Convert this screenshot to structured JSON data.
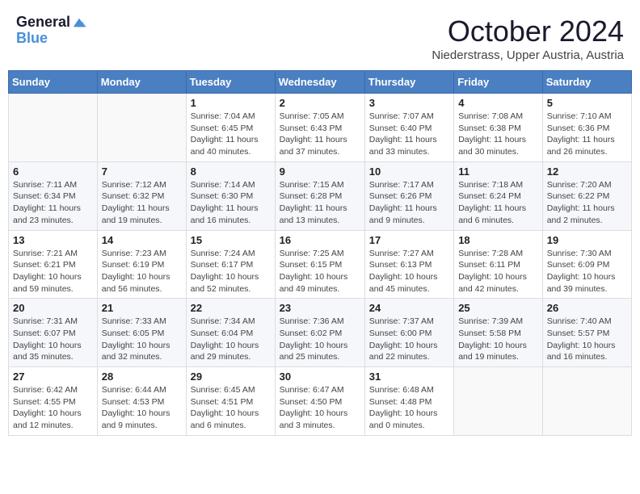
{
  "header": {
    "logo_line1": "General",
    "logo_line2": "Blue",
    "month_title": "October 2024",
    "location": "Niederstrass, Upper Austria, Austria"
  },
  "weekdays": [
    "Sunday",
    "Monday",
    "Tuesday",
    "Wednesday",
    "Thursday",
    "Friday",
    "Saturday"
  ],
  "weeks": [
    [
      {
        "day": "",
        "content": ""
      },
      {
        "day": "",
        "content": ""
      },
      {
        "day": "1",
        "content": "Sunrise: 7:04 AM\nSunset: 6:45 PM\nDaylight: 11 hours and 40 minutes."
      },
      {
        "day": "2",
        "content": "Sunrise: 7:05 AM\nSunset: 6:43 PM\nDaylight: 11 hours and 37 minutes."
      },
      {
        "day": "3",
        "content": "Sunrise: 7:07 AM\nSunset: 6:40 PM\nDaylight: 11 hours and 33 minutes."
      },
      {
        "day": "4",
        "content": "Sunrise: 7:08 AM\nSunset: 6:38 PM\nDaylight: 11 hours and 30 minutes."
      },
      {
        "day": "5",
        "content": "Sunrise: 7:10 AM\nSunset: 6:36 PM\nDaylight: 11 hours and 26 minutes."
      }
    ],
    [
      {
        "day": "6",
        "content": "Sunrise: 7:11 AM\nSunset: 6:34 PM\nDaylight: 11 hours and 23 minutes."
      },
      {
        "day": "7",
        "content": "Sunrise: 7:12 AM\nSunset: 6:32 PM\nDaylight: 11 hours and 19 minutes."
      },
      {
        "day": "8",
        "content": "Sunrise: 7:14 AM\nSunset: 6:30 PM\nDaylight: 11 hours and 16 minutes."
      },
      {
        "day": "9",
        "content": "Sunrise: 7:15 AM\nSunset: 6:28 PM\nDaylight: 11 hours and 13 minutes."
      },
      {
        "day": "10",
        "content": "Sunrise: 7:17 AM\nSunset: 6:26 PM\nDaylight: 11 hours and 9 minutes."
      },
      {
        "day": "11",
        "content": "Sunrise: 7:18 AM\nSunset: 6:24 PM\nDaylight: 11 hours and 6 minutes."
      },
      {
        "day": "12",
        "content": "Sunrise: 7:20 AM\nSunset: 6:22 PM\nDaylight: 11 hours and 2 minutes."
      }
    ],
    [
      {
        "day": "13",
        "content": "Sunrise: 7:21 AM\nSunset: 6:21 PM\nDaylight: 10 hours and 59 minutes."
      },
      {
        "day": "14",
        "content": "Sunrise: 7:23 AM\nSunset: 6:19 PM\nDaylight: 10 hours and 56 minutes."
      },
      {
        "day": "15",
        "content": "Sunrise: 7:24 AM\nSunset: 6:17 PM\nDaylight: 10 hours and 52 minutes."
      },
      {
        "day": "16",
        "content": "Sunrise: 7:25 AM\nSunset: 6:15 PM\nDaylight: 10 hours and 49 minutes."
      },
      {
        "day": "17",
        "content": "Sunrise: 7:27 AM\nSunset: 6:13 PM\nDaylight: 10 hours and 45 minutes."
      },
      {
        "day": "18",
        "content": "Sunrise: 7:28 AM\nSunset: 6:11 PM\nDaylight: 10 hours and 42 minutes."
      },
      {
        "day": "19",
        "content": "Sunrise: 7:30 AM\nSunset: 6:09 PM\nDaylight: 10 hours and 39 minutes."
      }
    ],
    [
      {
        "day": "20",
        "content": "Sunrise: 7:31 AM\nSunset: 6:07 PM\nDaylight: 10 hours and 35 minutes."
      },
      {
        "day": "21",
        "content": "Sunrise: 7:33 AM\nSunset: 6:05 PM\nDaylight: 10 hours and 32 minutes."
      },
      {
        "day": "22",
        "content": "Sunrise: 7:34 AM\nSunset: 6:04 PM\nDaylight: 10 hours and 29 minutes."
      },
      {
        "day": "23",
        "content": "Sunrise: 7:36 AM\nSunset: 6:02 PM\nDaylight: 10 hours and 25 minutes."
      },
      {
        "day": "24",
        "content": "Sunrise: 7:37 AM\nSunset: 6:00 PM\nDaylight: 10 hours and 22 minutes."
      },
      {
        "day": "25",
        "content": "Sunrise: 7:39 AM\nSunset: 5:58 PM\nDaylight: 10 hours and 19 minutes."
      },
      {
        "day": "26",
        "content": "Sunrise: 7:40 AM\nSunset: 5:57 PM\nDaylight: 10 hours and 16 minutes."
      }
    ],
    [
      {
        "day": "27",
        "content": "Sunrise: 6:42 AM\nSunset: 4:55 PM\nDaylight: 10 hours and 12 minutes."
      },
      {
        "day": "28",
        "content": "Sunrise: 6:44 AM\nSunset: 4:53 PM\nDaylight: 10 hours and 9 minutes."
      },
      {
        "day": "29",
        "content": "Sunrise: 6:45 AM\nSunset: 4:51 PM\nDaylight: 10 hours and 6 minutes."
      },
      {
        "day": "30",
        "content": "Sunrise: 6:47 AM\nSunset: 4:50 PM\nDaylight: 10 hours and 3 minutes."
      },
      {
        "day": "31",
        "content": "Sunrise: 6:48 AM\nSunset: 4:48 PM\nDaylight: 10 hours and 0 minutes."
      },
      {
        "day": "",
        "content": ""
      },
      {
        "day": "",
        "content": ""
      }
    ]
  ]
}
